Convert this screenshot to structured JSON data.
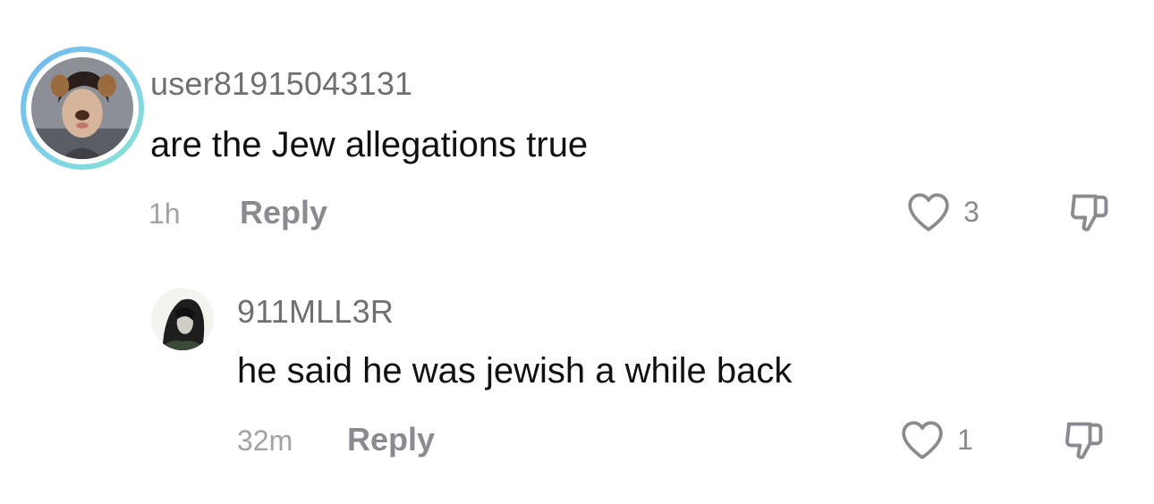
{
  "comments": [
    {
      "username": "user81915043131",
      "text": "are the Jew allegations true",
      "time": "1h",
      "reply_label": "Reply",
      "like_count": "3"
    }
  ],
  "replies": [
    {
      "username": "911MLL3R",
      "text": "he said he was jewish a while back",
      "time": "32m",
      "reply_label": "Reply",
      "like_count": "1"
    }
  ],
  "colors": {
    "story_ring": "#7fd3e8",
    "secondary_text": "#8a8b91"
  },
  "icons": [
    "heart-outline-icon",
    "thumbs-down-icon"
  ]
}
